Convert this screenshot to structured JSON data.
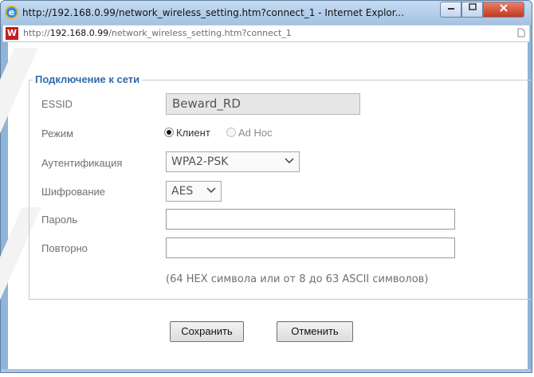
{
  "window": {
    "title": "http://192.168.0.99/network_wireless_setting.htm?connect_1 - Internet Explor...",
    "minimize": "—",
    "maximize": "□",
    "close": "x"
  },
  "address": {
    "prefix": "http://",
    "host": "192.168.0.99",
    "path": "/network_wireless_setting.htm?connect_1"
  },
  "form": {
    "legend": "Подключение к сети",
    "essid_label": "ESSID",
    "essid_value": "Beward_RD",
    "mode_label": "Режим",
    "mode_options": [
      "Клиент",
      "Ad Hoc"
    ],
    "mode_selected": "Клиент",
    "auth_label": "Аутентификация",
    "auth_value": "WPA2-PSK",
    "encryption_label": "Шифрование",
    "encryption_value": "AES",
    "password_label": "Пароль",
    "password_value": "",
    "repeat_label": "Повторно",
    "repeat_value": "",
    "hint": "(64 HEX символа или от 8 до 63 ASCII символов)"
  },
  "buttons": {
    "save": "Сохранить",
    "cancel": "Отменить"
  },
  "colors": {
    "legend": "#2f6bad",
    "label": "#707070",
    "close_button": "#c2391c"
  },
  "icons": {
    "browser": "internet-explorer-icon",
    "site": "site-favicon-icon",
    "page": "page-icon"
  }
}
